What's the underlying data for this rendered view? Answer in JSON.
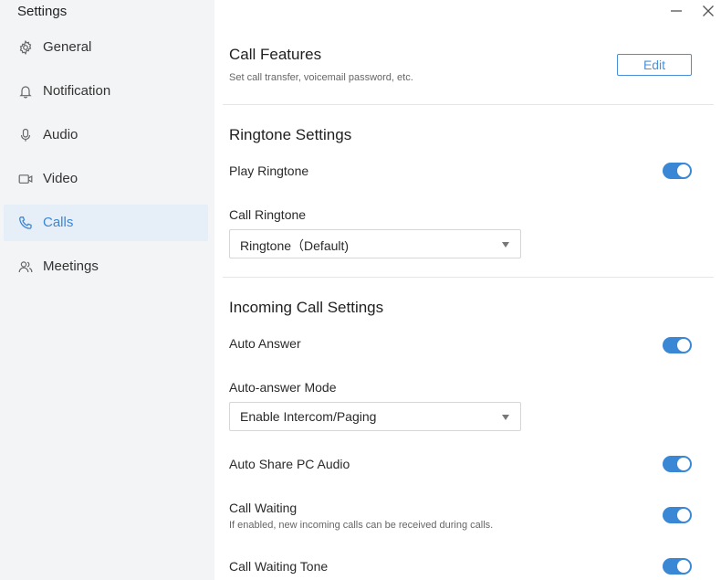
{
  "app": {
    "title": "Settings"
  },
  "sidebar": {
    "items": [
      {
        "label": "General",
        "icon": "gear-icon"
      },
      {
        "label": "Notification",
        "icon": "bell-icon"
      },
      {
        "label": "Audio",
        "icon": "microphone-icon"
      },
      {
        "label": "Video",
        "icon": "video-camera-icon"
      },
      {
        "label": "Calls",
        "icon": "phone-icon",
        "active": true
      },
      {
        "label": "Meetings",
        "icon": "people-icon"
      }
    ]
  },
  "window": {
    "minimize_icon": "minimize-icon",
    "close_icon": "close-icon"
  },
  "call_features": {
    "title": "Call Features",
    "description": "Set call transfer, voicemail password, etc.",
    "edit_label": "Edit"
  },
  "ringtone_settings": {
    "title": "Ringtone Settings",
    "play_ringtone": {
      "label": "Play Ringtone",
      "enabled": true
    },
    "call_ringtone": {
      "label": "Call Ringtone",
      "value": "Ringtone（Default)"
    }
  },
  "incoming_call_settings": {
    "title": "Incoming Call Settings",
    "auto_answer": {
      "label": "Auto Answer",
      "enabled": true
    },
    "auto_answer_mode": {
      "label": "Auto-answer Mode",
      "value": "Enable Intercom/Paging"
    },
    "auto_share_pc_audio": {
      "label": "Auto Share PC Audio",
      "enabled": true
    },
    "call_waiting": {
      "label": "Call Waiting",
      "description": "If enabled, new incoming calls can be received during calls.",
      "enabled": true
    },
    "call_waiting_tone": {
      "label": "Call Waiting Tone",
      "enabled": true
    }
  },
  "colors": {
    "accent": "#3a87d6",
    "sidebar_bg": "#f3f4f6",
    "active_bg": "#e6eef8"
  }
}
